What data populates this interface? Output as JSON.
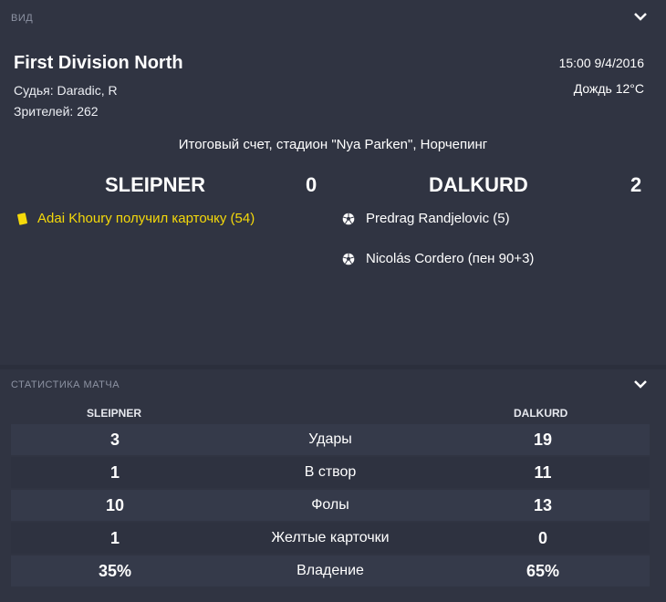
{
  "view": {
    "section_title": "ВИД",
    "league": "First Division North",
    "referee": "Судья: Daradic, R",
    "attendance": "Зрителей: 262",
    "datetime": "15:00 9/4/2016",
    "weather": "Дождь 12°C",
    "final_line": "Итоговый счет, стадион \"Nya Parken\", Норчепинг",
    "home_team": "SLEIPNER",
    "home_score": "0",
    "away_team": "DALKURD",
    "away_score": "2",
    "home_events": [
      {
        "icon": "yellow-card-icon",
        "text": "Adai Khoury получил карточку (54)"
      }
    ],
    "away_events": [
      {
        "icon": "football-icon",
        "text": "Predrag Randjelovic (5)"
      },
      {
        "icon": "football-icon",
        "text": "Nicolás Cordero (пен 90+3)"
      }
    ],
    "accent_yellow": "#f5d90a"
  },
  "stats": {
    "section_title": "СТАТИСТИКА МАТЧА",
    "home_team": "SLEIPNER",
    "away_team": "DALKURD",
    "rows": [
      {
        "home": "3",
        "label": "Удары",
        "away": "19"
      },
      {
        "home": "1",
        "label": "В створ",
        "away": "11"
      },
      {
        "home": "10",
        "label": "Фолы",
        "away": "13"
      },
      {
        "home": "1",
        "label": "Желтые карточки",
        "away": "0"
      },
      {
        "home": "35%",
        "label": "Владение",
        "away": "65%"
      }
    ]
  }
}
